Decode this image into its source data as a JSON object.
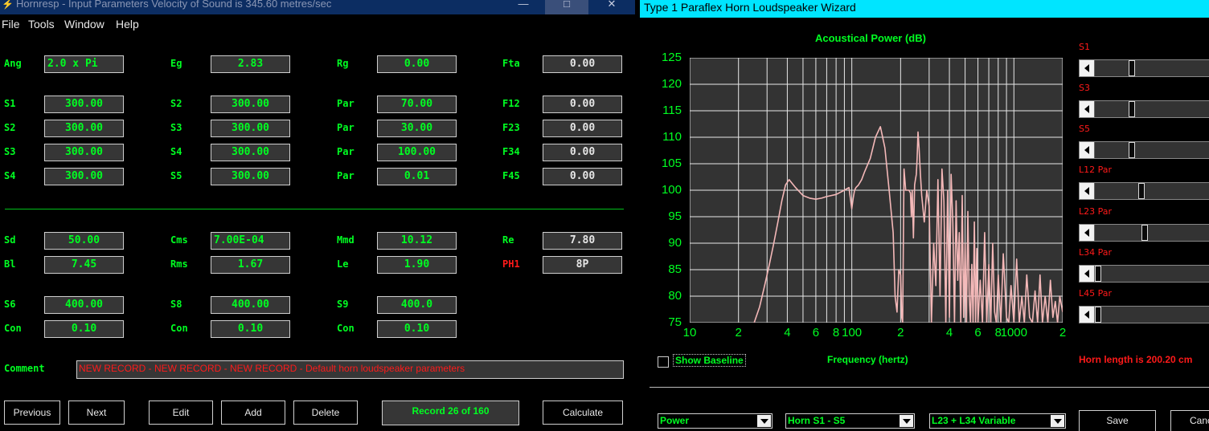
{
  "left_window": {
    "title": "Hornresp - Input Parameters   Velocity of Sound is 345.60 metres/sec",
    "caption_buttons": {
      "minimize": "—",
      "maximize": "□",
      "close": "✕"
    },
    "menu": [
      "File",
      "Tools",
      "Window",
      "Help"
    ],
    "rows": {
      "r0": [
        {
          "label": "Ang",
          "value": "2.0 x Pi"
        },
        {
          "label": "Eg",
          "value": "2.83"
        },
        {
          "label": "Rg",
          "value": "0.00"
        },
        {
          "label": "Fta",
          "value": "0.00"
        }
      ],
      "r1": [
        {
          "label": "S1",
          "value": "300.00"
        },
        {
          "label": "S2",
          "value": "300.00"
        },
        {
          "label": "Par",
          "value": "70.00"
        },
        {
          "label": "F12",
          "value": "0.00"
        }
      ],
      "r2": [
        {
          "label": "S2",
          "value": "300.00"
        },
        {
          "label": "S3",
          "value": "300.00"
        },
        {
          "label": "Par",
          "value": "30.00"
        },
        {
          "label": "F23",
          "value": "0.00"
        }
      ],
      "r3": [
        {
          "label": "S3",
          "value": "300.00"
        },
        {
          "label": "S4",
          "value": "300.00"
        },
        {
          "label": "Par",
          "value": "100.00"
        },
        {
          "label": "F34",
          "value": "0.00"
        }
      ],
      "r4": [
        {
          "label": "S4",
          "value": "300.00"
        },
        {
          "label": "S5",
          "value": "300.00"
        },
        {
          "label": "Par",
          "value": "0.01"
        },
        {
          "label": "F45",
          "value": "0.00"
        }
      ],
      "r5": [
        {
          "label": "Sd",
          "value": "50.00"
        },
        {
          "label": "Cms",
          "value": "7.00E-04"
        },
        {
          "label": "Mmd",
          "value": "10.12"
        },
        {
          "label": "Re",
          "value": "7.80"
        }
      ],
      "r6": [
        {
          "label": "Bl",
          "value": "7.45"
        },
        {
          "label": "Rms",
          "value": "1.67"
        },
        {
          "label": "Le",
          "value": "1.90"
        },
        {
          "label": "PH1",
          "value": "8P"
        }
      ],
      "r7": [
        {
          "label": "S6",
          "value": "400.00"
        },
        {
          "label": "S8",
          "value": "400.00"
        },
        {
          "label": "S9",
          "value": "400.0"
        }
      ],
      "r8": [
        {
          "label": "Con",
          "value": "0.10"
        },
        {
          "label": "Con",
          "value": "0.10"
        },
        {
          "label": "Con",
          "value": "0.10"
        }
      ]
    },
    "comment_label": "Comment",
    "comment_value": "NEW RECORD - NEW RECORD - NEW RECORD - Default horn loudspeaker parameters",
    "buttons": {
      "previous": "Previous",
      "next": "Next",
      "edit": "Edit",
      "add": "Add",
      "delete": "Delete",
      "calculate": "Calculate"
    },
    "record_status": "Record 26 of 160"
  },
  "right_window": {
    "title": "Type 1 Paraflex Horn Loudspeaker Wizard",
    "show_baseline": "Show Baseline",
    "horn_length": "Horn length is 200.20 cm",
    "sliders": [
      {
        "label": "S1",
        "position": 0.35
      },
      {
        "label": "S3",
        "position": 0.35
      },
      {
        "label": "S5",
        "position": 0.35
      },
      {
        "label": "L12 Par",
        "position": 0.45
      },
      {
        "label": "L23 Par",
        "position": 0.48
      },
      {
        "label": "L34 Par",
        "position": 0.0
      },
      {
        "label": "L45 Par",
        "position": 0.0
      }
    ],
    "combos": {
      "a": "Power",
      "b": "Horn S1 - S5",
      "c": "L23 + L34 Variable"
    },
    "buttons": {
      "save": "Save",
      "cancel": "Canc"
    }
  },
  "chart_data": {
    "type": "line",
    "title": "Acoustical Power (dB)",
    "xlabel": "Frequency (hertz)",
    "ylabel": "",
    "x_scale": "log",
    "xlim": [
      10,
      2000
    ],
    "ylim": [
      75,
      125
    ],
    "yticks": [
      75,
      80,
      85,
      90,
      95,
      100,
      105,
      110,
      115,
      120,
      125
    ],
    "xtick_labels": [
      "10",
      "2",
      "4",
      "6",
      "8",
      "100",
      "2",
      "4",
      "6",
      "8",
      "1000",
      "2"
    ],
    "grid": true,
    "line_color": "#f4b8b8",
    "series": [
      {
        "x": [
          25,
          27,
          29,
          31,
          33,
          35,
          37,
          39,
          41,
          45,
          50,
          55,
          60,
          65,
          70,
          80,
          90,
          96,
          100,
          102,
          104,
          106,
          110,
          115,
          120,
          130,
          140,
          150,
          160,
          170,
          180,
          185,
          190,
          195,
          200,
          203,
          206,
          210,
          215,
          220,
          225,
          230,
          233,
          236,
          240,
          244,
          247,
          250,
          253,
          256,
          260,
          265,
          270,
          280,
          290,
          300,
          310,
          320,
          330,
          340,
          350,
          360,
          370,
          380,
          390,
          400,
          410,
          420,
          430,
          440,
          450,
          460,
          470,
          480,
          490,
          500,
          510,
          520,
          530,
          540,
          550,
          560,
          570,
          580,
          590,
          600,
          620,
          640,
          660,
          680,
          700,
          720,
          740,
          760,
          780,
          800,
          830,
          860,
          900,
          930,
          960,
          1000,
          1040,
          1080,
          1120,
          1160,
          1200,
          1250,
          1300,
          1350,
          1400,
          1450,
          1500,
          1560,
          1620,
          1680,
          1740,
          1800,
          1860,
          1920,
          2000
        ],
        "y": [
          75,
          78,
          82,
          86,
          90,
          94,
          98,
          101,
          102,
          100.5,
          99,
          98.5,
          98.3,
          98.5,
          98.8,
          99.2,
          100,
          100.5,
          96.5,
          98.5,
          100,
          100.5,
          101,
          102,
          103.5,
          106,
          110,
          112,
          108,
          100,
          92,
          80,
          77,
          85,
          84,
          76,
          75,
          104,
          100,
          100,
          100,
          99.5,
          95,
          100,
          91,
          101,
          102,
          103,
          106,
          111,
          108,
          103,
          99,
          94,
          100,
          97,
          75,
          90,
          82,
          102,
          80,
          104,
          98,
          75,
          100,
          76,
          103,
          94,
          75,
          98,
          83,
          92,
          75,
          99,
          76,
          90,
          75,
          96,
          80,
          75,
          86,
          75,
          94,
          75,
          89,
          75,
          83,
          75,
          92,
          75,
          86,
          75,
          90,
          77,
          75,
          84,
          75,
          88,
          76,
          75,
          82,
          75,
          87,
          75,
          80,
          75,
          84,
          76,
          75,
          81,
          75,
          84,
          75,
          80,
          75,
          83,
          76,
          79,
          75,
          80,
          77
        ]
      }
    ]
  }
}
